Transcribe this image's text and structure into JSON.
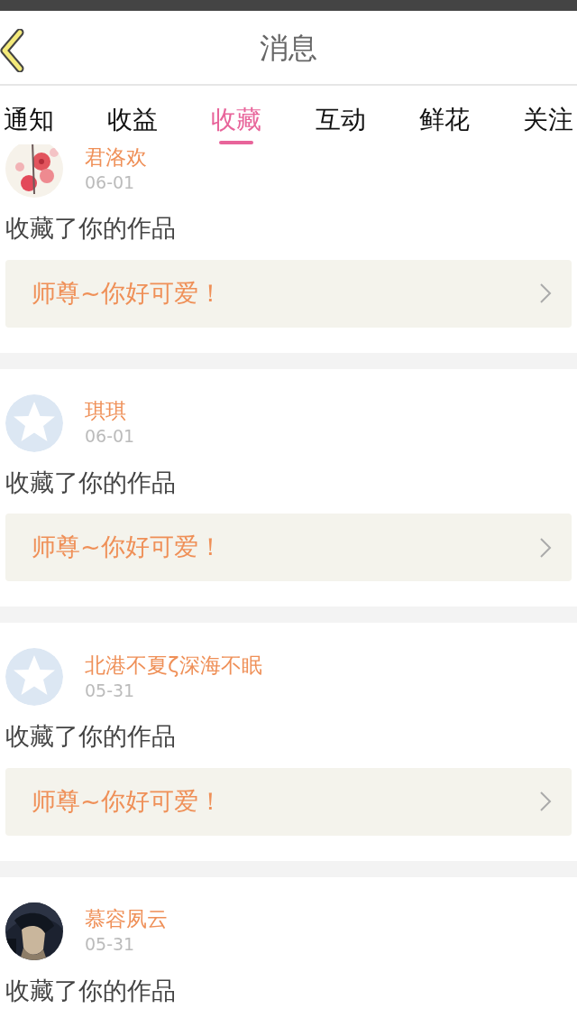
{
  "header": {
    "title": "消息"
  },
  "tabs": [
    {
      "label": "通知",
      "selected": false
    },
    {
      "label": "收益",
      "selected": false
    },
    {
      "label": "收藏",
      "selected": true
    },
    {
      "label": "互动",
      "selected": false
    },
    {
      "label": "鲜花",
      "selected": false
    },
    {
      "label": "关注",
      "selected": false
    }
  ],
  "messages": [
    {
      "name": "君洛欢",
      "date": "06-01",
      "action": "收藏了你的作品",
      "work": "师尊~你好可爱！"
    },
    {
      "avatar": {
        "kind": "default"
      },
      "name": "琪琪",
      "date": "06-01",
      "action": "收藏了你的作品",
      "work": "师尊~你好可爱！"
    },
    {
      "avatar": {
        "kind": "default"
      },
      "name": "北港不夏ζ深海不眠",
      "date": "05-31",
      "action": "收藏了你的作品",
      "work": "师尊~你好可爱！"
    },
    {
      "name": "慕容夙云",
      "date": "05-31",
      "action": "收藏了你的作品"
    }
  ]
}
